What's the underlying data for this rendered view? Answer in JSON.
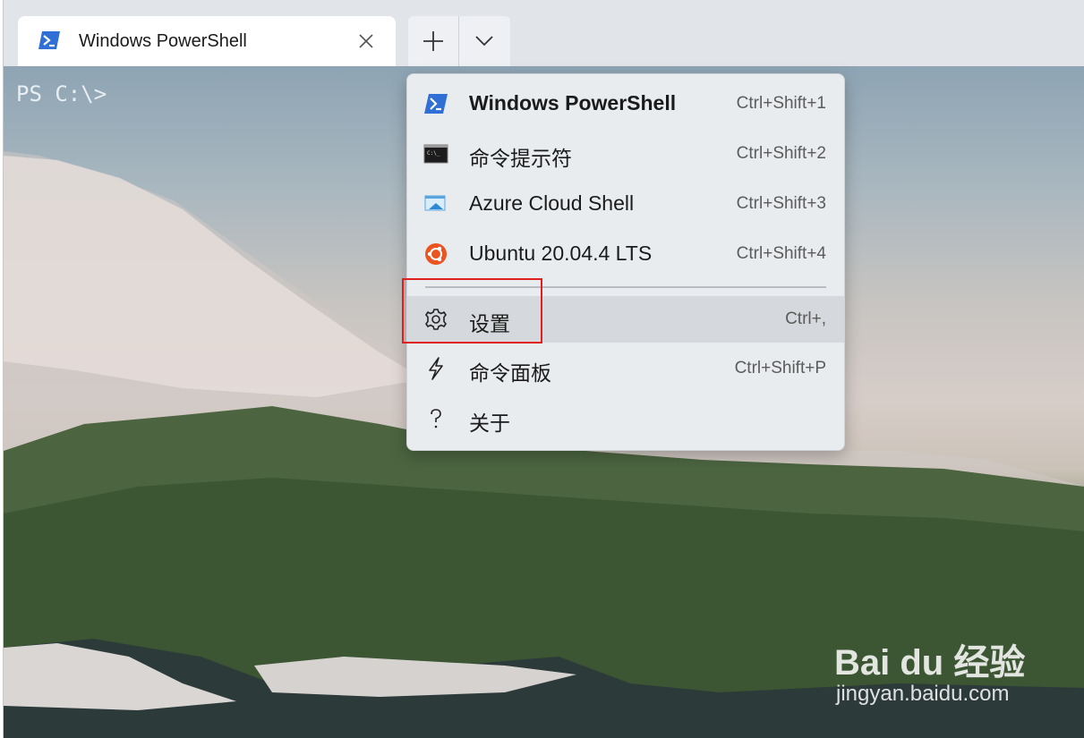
{
  "tab": {
    "title": "Windows PowerShell",
    "icon": "powershell-icon",
    "close_icon": "close-icon"
  },
  "toolbar": {
    "new_tab_icon": "plus-icon",
    "dropdown_icon": "chevron-down-icon"
  },
  "terminal": {
    "prompt": "PS C:\\>"
  },
  "menu": {
    "items": [
      {
        "label": "Windows PowerShell",
        "shortcut": "Ctrl+Shift+1",
        "icon": "powershell-icon"
      },
      {
        "label": "命令提示符",
        "shortcut": "Ctrl+Shift+2",
        "icon": "command-prompt-icon"
      },
      {
        "label": "Azure Cloud Shell",
        "shortcut": "Ctrl+Shift+3",
        "icon": "azure-cloud-shell-icon"
      },
      {
        "label": "Ubuntu 20.04.4 LTS",
        "shortcut": "Ctrl+Shift+4",
        "icon": "ubuntu-icon"
      },
      {
        "label": "设置",
        "shortcut": "Ctrl+,",
        "icon": "gear-icon"
      },
      {
        "label": "命令面板",
        "shortcut": "Ctrl+Shift+P",
        "icon": "lightning-icon"
      },
      {
        "label": "关于",
        "shortcut": "",
        "icon": "question-icon"
      }
    ]
  },
  "watermark": {
    "brand": "Bai du 经验",
    "url": "jingyan.baidu.com"
  },
  "colors": {
    "annotation_border": "#e02020",
    "powershell_blue": "#2f6fd6",
    "ubuntu_orange": "#e95420"
  }
}
